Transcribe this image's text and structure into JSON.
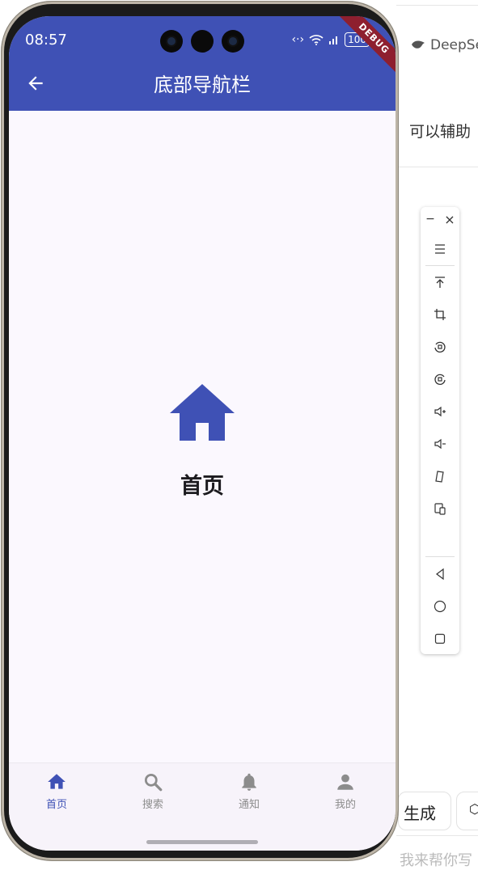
{
  "host_page": {
    "brand": "DeepSe",
    "assist_text": "可以辅助",
    "generate_label": "生成",
    "write_placeholder": "我来帮你写"
  },
  "status_bar": {
    "time": "08:57",
    "battery": "100"
  },
  "app_bar": {
    "title": "底部导航栏",
    "debug_banner": "DEBUG",
    "color": "#3f51b5"
  },
  "body": {
    "icon": "home-icon",
    "label": "首页"
  },
  "bottom_nav": {
    "active_color": "#3f51b5",
    "inactive_color": "#8c8c8c",
    "items": [
      {
        "label": "首页",
        "icon": "home-icon",
        "active": true
      },
      {
        "label": "搜索",
        "icon": "search-icon",
        "active": false
      },
      {
        "label": "通知",
        "icon": "bell-icon",
        "active": false
      },
      {
        "label": "我的",
        "icon": "person-icon",
        "active": false
      }
    ]
  },
  "emulator_toolbar": {
    "minimize": "−",
    "close": "×",
    "buttons": [
      "menu-icon",
      "top-icon",
      "crop-icon",
      "rotate-left-icon",
      "rotate-right-icon",
      "volume-up-icon",
      "volume-down-icon",
      "fold-icon",
      "screen-mirror-icon",
      "back-icon",
      "home-circle-icon",
      "overview-icon"
    ]
  }
}
